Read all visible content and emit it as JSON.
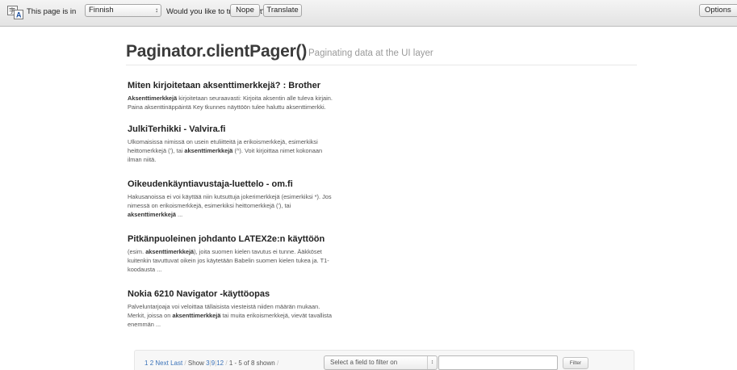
{
  "translate_bar": {
    "icon": "translate-icon",
    "page_is_in": "This page is in",
    "language": "Finnish",
    "question": "Would you like to translate it?",
    "nope": "Nope",
    "translate": "Translate",
    "options": "Options"
  },
  "header": {
    "title": "Paginator.clientPager()",
    "subtitle": "Paginating data at the UI layer"
  },
  "results": [
    {
      "title": "Miten kirjoitetaan aksenttimerkkejä? : Brother",
      "lines": [
        [
          {
            "b": "Aksenttimerkkejä"
          },
          {
            "t": " kirjoitetaan seuraavasti: Kirjoita aksentin alle tuleva kirjain."
          }
        ],
        [
          {
            "t": "Paina aksenttinäppäintä Key tkunnes näyttöön tulee haluttu aksenttimerkki."
          }
        ]
      ]
    },
    {
      "title": "JulkiTerhikki - Valvira.fi",
      "lines": [
        [
          {
            "t": "Ulkomaisissa nimissä on usein etuliitteitä ja erikoismerkkejä, esimerkiksi"
          }
        ],
        [
          {
            "t": "heittomerkkejä ('), tai "
          },
          {
            "b": "aksenttimerkkejä"
          },
          {
            "t": " (^). Voit kirjoittaa nimet kokonaan"
          }
        ],
        [
          {
            "t": "ilman niitä."
          }
        ]
      ]
    },
    {
      "title": "Oikeudenkäyntiavustaja-luettelo - om.fi",
      "lines": [
        [
          {
            "t": "Hakusanoissa ei voi käyttää niin kutsuttuja jokerimerkkejä (esimerkiksi *). Jos"
          }
        ],
        [
          {
            "t": "nimessä on erikoismerkkejä, esimerkiksi heittomerkkejä ('), tai"
          }
        ],
        [
          {
            "b": "aksenttimerkkejä"
          },
          {
            "t": " ..."
          }
        ]
      ]
    },
    {
      "title": "Pitkänpuoleinen johdanto LATEX2e:n käyttöön",
      "lines": [
        [
          {
            "t": "(esim. "
          },
          {
            "b": "aksenttimerkkejä"
          },
          {
            "t": "), joita suomen kielen tavutus ei tunne. Ääkköset"
          }
        ],
        [
          {
            "t": "kuitenkin tavuttuvat oikein jos käytetään Babelin suomen kielen tukea ja. T1-"
          }
        ],
        [
          {
            "t": "koodausta ..."
          }
        ]
      ]
    },
    {
      "title": "Nokia 6210 Navigator -käyttöopas",
      "lines": [
        [
          {
            "t": "Palveluntarjoaja voi veloittaa tällaisista viesteistä niiden määrän mukaan."
          }
        ],
        [
          {
            "t": "Merkit, joissa on "
          },
          {
            "b": "aksenttimerkkejä"
          },
          {
            "t": " tai muita erikoismerkkejä, vievät tavallista"
          }
        ],
        [
          {
            "t": "enemmän ..."
          }
        ]
      ]
    }
  ],
  "pager": {
    "page_1": "1",
    "page_2": "2",
    "next": "Next",
    "last": "Last",
    "sep": "/",
    "show_label": "Show",
    "show_3": "3",
    "show_9": "9",
    "show_12": "12",
    "bar": "|",
    "shown": "1 - 5 of 8 shown",
    "filter_placeholder": "Select a field to filter on",
    "filter_value": "",
    "filter_button": "Filter"
  }
}
